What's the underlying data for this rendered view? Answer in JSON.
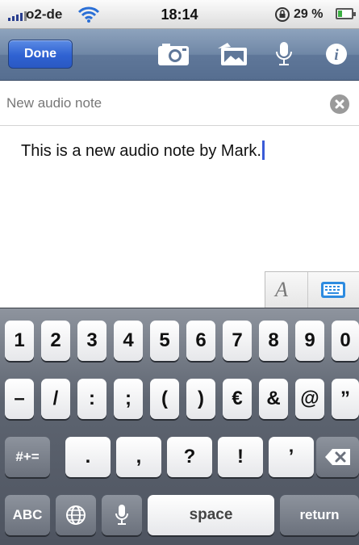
{
  "status_bar": {
    "carrier": "o2-de",
    "time": "18:14",
    "battery_text": "29 %",
    "battery_level": 0.29,
    "icons": [
      "signal-icon",
      "wifi-icon",
      "rotation-lock-icon",
      "battery-icon"
    ]
  },
  "toolbar": {
    "done_label": "Done",
    "icons": [
      "camera-icon",
      "photo-library-icon",
      "microphone-icon",
      "info-icon"
    ]
  },
  "note": {
    "title_placeholder": "New audio note",
    "body_text": "This is a new audio note by Mark."
  },
  "accessory": {
    "font_label": "A",
    "icons": [
      "font-style-icon",
      "keyboard-icon"
    ]
  },
  "keyboard": {
    "row1": [
      "1",
      "2",
      "3",
      "4",
      "5",
      "6",
      "7",
      "8",
      "9",
      "0"
    ],
    "row2": [
      "–",
      "/",
      ":",
      ";",
      "(",
      ")",
      "€",
      "&",
      "@",
      "”"
    ],
    "row3": {
      "shift": "#+=",
      "keys": [
        ".",
        ",",
        "?",
        "!",
        "’"
      ],
      "backspace_icon": "backspace-icon"
    },
    "row4": {
      "abc": "ABC",
      "globe_icon": "globe-icon",
      "mic_icon": "microphone-icon",
      "space": "space",
      "return": "return"
    }
  },
  "colors": {
    "toolbar": "#6f87a6",
    "done_button": "#2f62d2",
    "caret": "#3a5bd7",
    "keyboard_bg": "#5d6470"
  }
}
